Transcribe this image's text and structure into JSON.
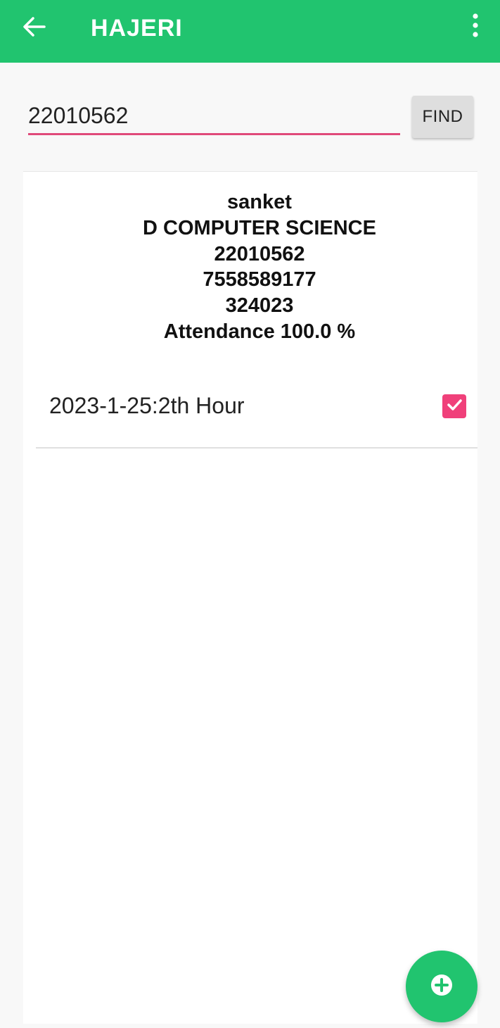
{
  "app_bar": {
    "title": "HAJERI",
    "back_icon": "arrow-left-icon",
    "menu_icon": "more-vert-icon",
    "background_color": "#21c46f"
  },
  "search": {
    "value": "22010562",
    "find_label": "FIND",
    "underline_color": "#e04a7a"
  },
  "student": {
    "name": "sanket",
    "department": "D COMPUTER SCIENCE",
    "enrollment_no": "22010562",
    "phone": "7558589177",
    "code": "324023",
    "attendance": "Attendance 100.0 %"
  },
  "sessions": [
    {
      "label": "2023-1-25:2th Hour",
      "checked": true
    }
  ],
  "fab": {
    "icon": "add-circle-icon"
  },
  "colors": {
    "accent": "#21c46f",
    "checkbox": "#f0407a"
  }
}
